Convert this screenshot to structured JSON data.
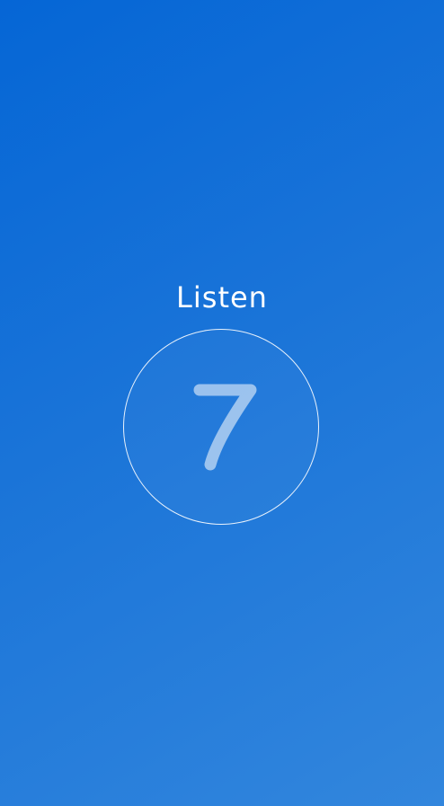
{
  "screen": {
    "title": "Listen",
    "countdown_value": "7",
    "colors": {
      "background_start": "#0566d6",
      "background_end": "#3286dd",
      "text": "#ffffff"
    }
  }
}
